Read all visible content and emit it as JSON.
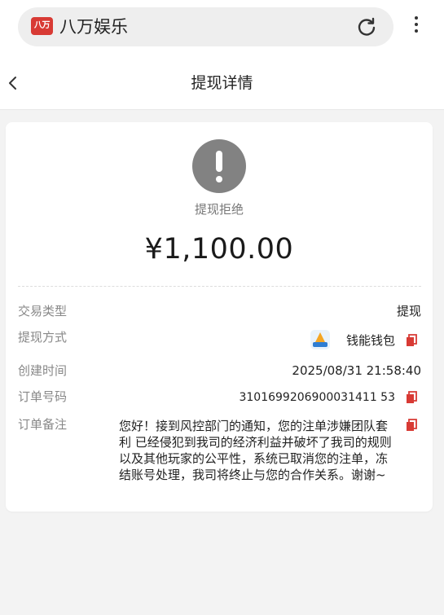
{
  "browser": {
    "logo_text": "八万",
    "site_title": "八万娱乐",
    "reload_icon": "reload-icon",
    "menu_icon": "more-vert-icon"
  },
  "header": {
    "title": "提现详情",
    "back_icon": "chevron-left-icon"
  },
  "status": {
    "icon": "exclamation-circle-icon",
    "text": "提现拒绝",
    "amount": "¥1,100.00"
  },
  "details": {
    "type_label": "交易类型",
    "type_value": "提现",
    "method_label": "提现方式",
    "method_value": "钱能钱包",
    "created_label": "创建时间",
    "created_value": "2025/08/31 21:58:40",
    "order_label": "订单号码",
    "order_value": "3101699206900031411 53",
    "remark_label": "订单备注",
    "remark_value": "您好！接到风控部门的通知，您的注单涉嫌团队套利 已经侵犯到我司的经济利益并破坏了我司的规则以及其他玩家的公平性，系统已取消您的注单，冻结账号处理，我司将终止与您的合作关系。谢谢~"
  },
  "colors": {
    "accent_red": "#d83a34",
    "status_gray": "#828282",
    "label_gray": "#888888"
  }
}
